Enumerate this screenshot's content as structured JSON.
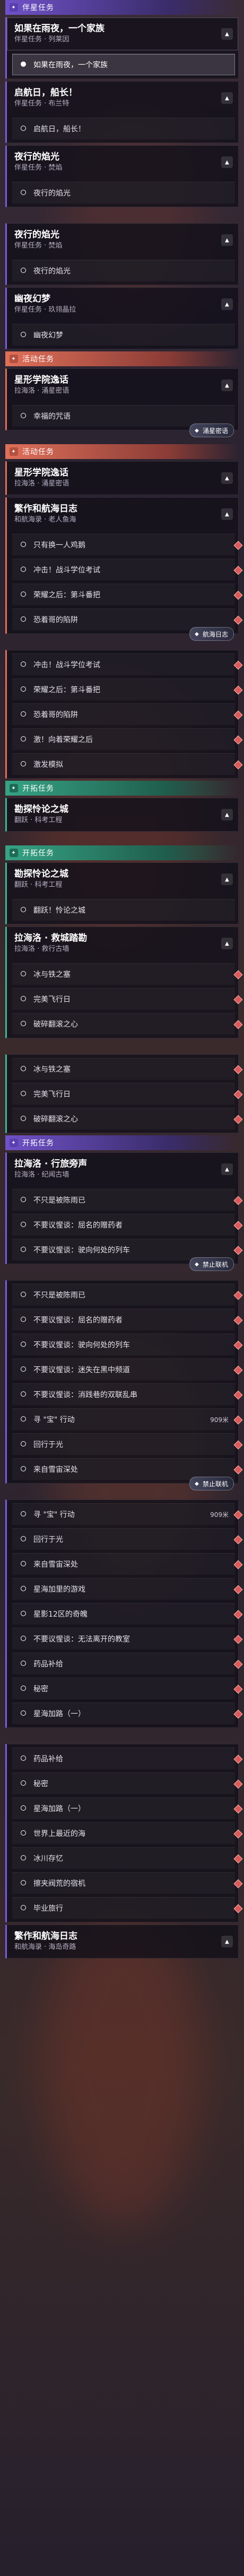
{
  "categories": {
    "companion": "伴星任务",
    "event": "活动任务",
    "trail": "开拓任务",
    "pioneer": "开拓任务"
  },
  "toggle_glyph": "▲",
  "dot_glyph": "",
  "quests": {
    "q1": {
      "title": "如果在雨夜，一个家族",
      "sub": "伴星任务 · 列莱因",
      "steps": [
        "如果在雨夜，一个家族"
      ]
    },
    "q2": {
      "title": "启航日，船长！",
      "sub": "伴星任务 · 布兰特",
      "steps": [
        "启航日，船长！"
      ]
    },
    "q3": {
      "title": "夜行的焰光",
      "sub": "伴星任务 · 焚焰",
      "steps": [
        "夜行的焰光"
      ]
    },
    "q4": {
      "title": "夜行的焰光",
      "sub": "伴星任务 · 焚焰",
      "steps": [
        "夜行的焰光"
      ]
    },
    "q5": {
      "title": "幽夜幻梦",
      "sub": "伴星任务 · 玖翎晶拉",
      "steps": [
        "幽夜幻梦"
      ]
    },
    "q6": {
      "title": "星形学院逸话",
      "sub": "拉海洛 · 涌星密语",
      "steps": [
        "幸福的咒语"
      ],
      "badge": "涌星密语"
    },
    "q7": {
      "title": "星形学院逸话",
      "sub": "拉海洛 · 涌星密语",
      "steps": []
    },
    "q8": {
      "title": "繁作和航海日志",
      "sub": "和航海录 · 老人鱼海",
      "steps": [
        "只有换一人鸡鹅",
        "冲击！战斗学位考试",
        "荣耀之后：第斗番把",
        "恐着哥的陷阱"
      ],
      "badge": "航海日志"
    },
    "q9": {
      "title": "",
      "sub": "",
      "steps": [
        "冲击！战斗学位考试",
        "荣耀之后：第斗番把",
        "恐着哥的陷阱",
        "激！向着荣耀之后",
        "激发模拟"
      ]
    },
    "q10": {
      "title": "勘探怜论之城",
      "sub": "翻跃 · 科考工程",
      "steps": []
    },
    "q11": {
      "title": "勘探怜论之城",
      "sub": "翻跃 · 科考工程",
      "steps": [
        "翻跃！怜论之城"
      ]
    },
    "q12": {
      "title": "拉海洛 · 救城踏勘",
      "sub": "拉海洛 · 救行古墙",
      "steps": [
        "冰与铁之塞",
        "完美飞行日",
        "破碎翻滚之心"
      ]
    },
    "q13": {
      "title": "",
      "sub": "",
      "steps": [
        "冰与铁之塞",
        "完美飞行日",
        "破碎翻滚之心"
      ]
    },
    "q14": {
      "title": "拉海洛 · 行旅旁声",
      "sub": "拉海洛 · 纪闻古墙",
      "steps": [
        "不只是被陈雨已",
        "不要议惺谈：屈名的赠药者",
        "不要议惺谈：驶向何处的列车"
      ],
      "badge": "禁止联机"
    },
    "q15": {
      "title": "",
      "sub": "",
      "steps": [
        "不只是被陈雨已",
        "不要议惺谈：屈名的赠药者",
        "不要议惺谈：驶向何处的列车",
        "不要议惺谈：迷失在黑中频道",
        "不要议惺谈：消践巷的双联乱串",
        "寻 \"宝\" 行动",
        "回行于光",
        "来自雪宙深处"
      ],
      "badge": "禁止联机",
      "dist": "909米"
    },
    "q16": {
      "title": "",
      "sub": "",
      "steps": [
        "寻 \"宝\" 行动",
        "回行于光",
        "来自雪宙深处",
        "星海加里的游戏",
        "星影12区的奇魄",
        "不要议惺谈：无法离开的教室",
        "药品补给",
        "秘密",
        "星海加路（一）"
      ],
      "dist": "909米"
    },
    "q17": {
      "title": "",
      "sub": "",
      "steps": [
        "药品补给",
        "秘密",
        "星海加路（一）",
        "世界上最近的海",
        "冰川存忆",
        "擦夹阀荒的宿机",
        "毕业旅行"
      ]
    },
    "q18": {
      "title": "繁作和航海日志",
      "sub": "和航海录 · 海岛奇路",
      "steps": []
    }
  },
  "badge_icon": "◆"
}
